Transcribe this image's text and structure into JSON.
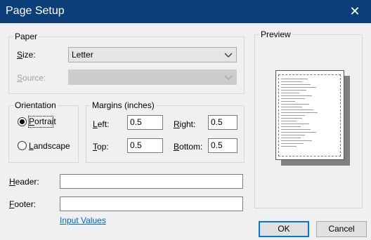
{
  "window": {
    "title": "Page Setup",
    "close_glyph": "✕"
  },
  "paper": {
    "legend": "Paper",
    "size_label": "Size:",
    "size_value": "Letter",
    "source_label": "Source:",
    "source_value": ""
  },
  "orientation": {
    "legend": "Orientation",
    "portrait": "Portrait",
    "landscape": "Landscape",
    "selected": "Portrait"
  },
  "margins": {
    "legend": "Margins (inches)",
    "left_label": "Left:",
    "left": "0.5",
    "right_label": "Right:",
    "right": "0.5",
    "top_label": "Top:",
    "top": "0.5",
    "bottom_label": "Bottom:",
    "bottom": "0.5"
  },
  "header": {
    "label": "Header:",
    "value": ""
  },
  "footer": {
    "label": "Footer:",
    "value": ""
  },
  "input_values_link": "Input Values",
  "preview": {
    "legend": "Preview"
  },
  "buttons": {
    "ok": "OK",
    "cancel": "Cancel"
  },
  "colors": {
    "titlebar": "#0c3f7a",
    "accent": "#0078d7",
    "link": "#0066cc"
  },
  "icons": {
    "close": "close-icon",
    "dropdown": "chevron-down-icon"
  }
}
